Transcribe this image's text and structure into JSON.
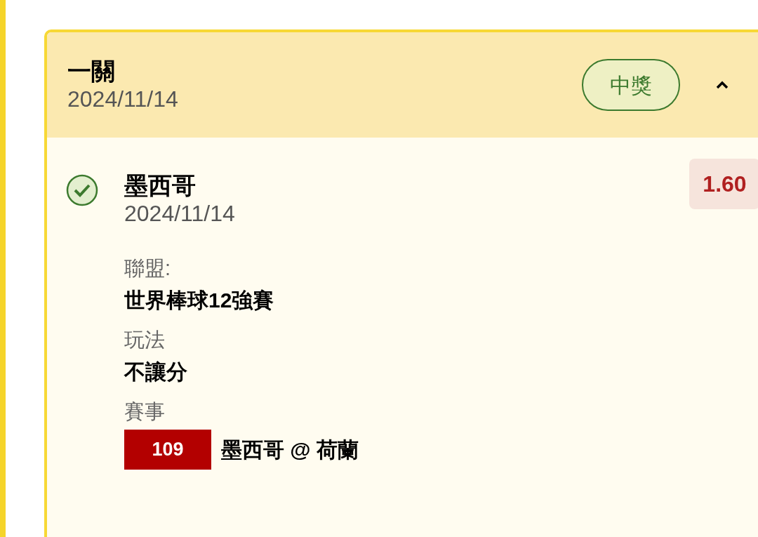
{
  "ticket": {
    "title": "一關",
    "date": "2024/11/14",
    "status": "中獎",
    "expanded": true,
    "legs": [
      {
        "won": true,
        "team": "墨西哥",
        "date": "2024/11/14",
        "odds": "1.60",
        "fields": [
          {
            "label": "聯盟:",
            "value": "世界棒球12強賽"
          },
          {
            "label": "玩法",
            "value": "不讓分"
          },
          {
            "label": "賽事",
            "code": "109",
            "value": "墨西哥 @ 荷蘭"
          }
        ]
      }
    ]
  }
}
